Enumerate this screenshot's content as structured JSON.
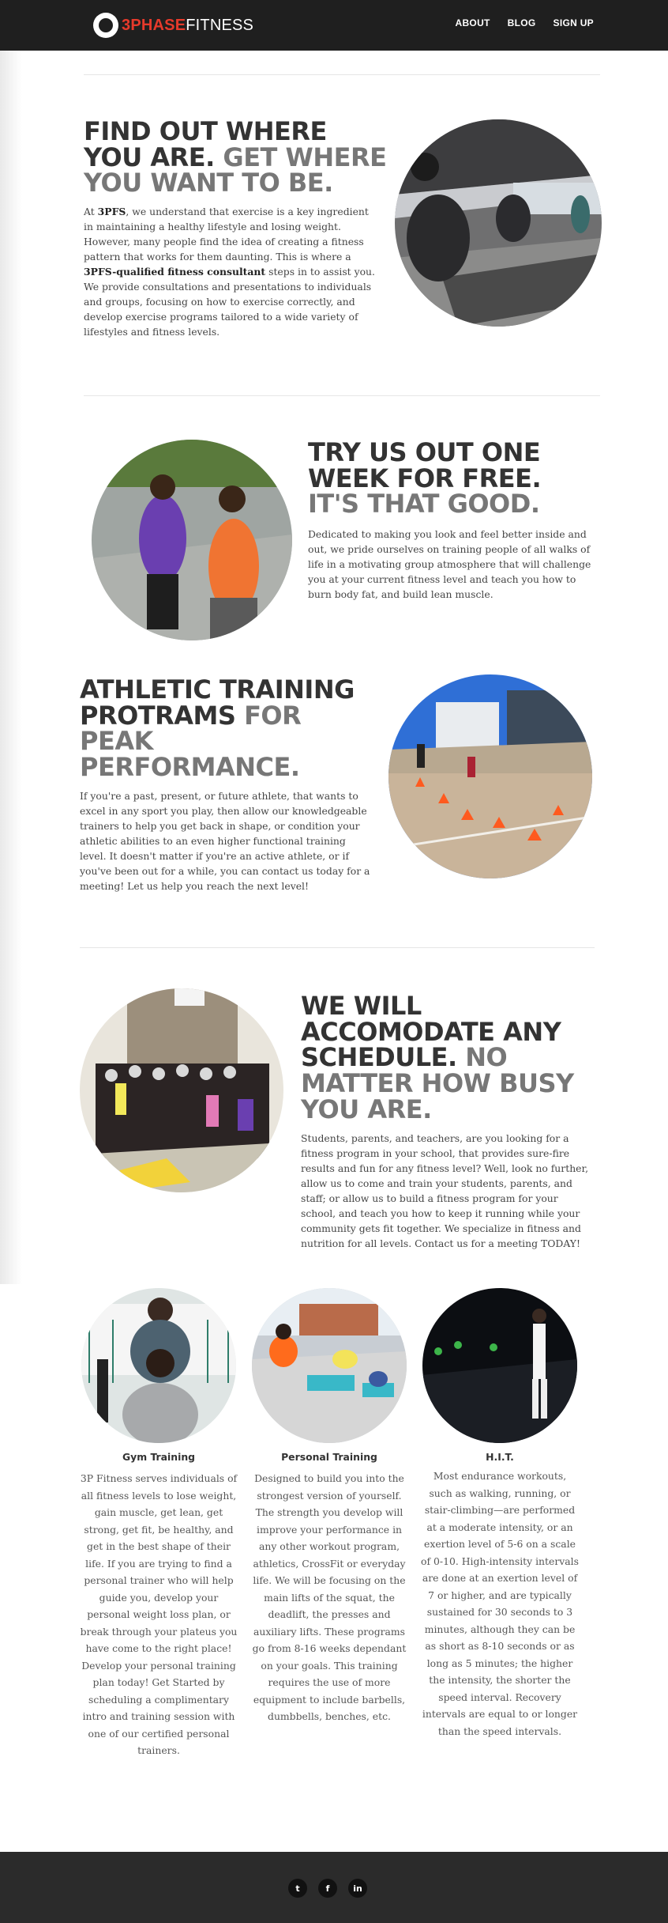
{
  "header": {
    "logo_mark_text": "3",
    "logo_number": "3",
    "logo_phase": "PHASE",
    "logo_fitness": "FITNESS",
    "nav": [
      "ABOUT",
      "BLOG",
      "SIGN UP"
    ]
  },
  "section1": {
    "heading_dark": "FIND OUT WHERE YOU ARE.",
    "heading_dim": "GET WHERE YOU WANT TO BE.",
    "p_before": "At ",
    "p_bold1": "3PFS",
    "p_mid": ", we understand that exercise is a key ingredient in maintaining a healthy lifestyle and losing weight. However, many people find the idea of creating a fitness pattern that works for them daunting. This is where a ",
    "p_bold2": "3PFS-qualified fitness consultant",
    "p_after": " steps in to assist you. We provide consultations and presentations to individuals and groups, focusing on  how to exercise correctly, and develop exercise programs tailored to a wide variety of  lifestyles and fitness levels."
  },
  "section2": {
    "heading_dark": "TRY US OUT ONE WEEK FOR FREE.",
    "heading_dim": "IT'S THAT GOOD.",
    "paragraph": "Dedicated to making you look and feel better inside and out, we pride ourselves on training people of all walks of life in a motivating group atmosphere that will challenge you at your current fitness level and teach you how to burn body fat, and build lean muscle."
  },
  "section3": {
    "heading_dark": "ATHLETIC TRAINING PROTRAMS",
    "heading_dim": "FOR PEAK PERFORMANCE.",
    "paragraph": "If you're a past, present, or future athlete, that wants to excel in any sport you play, then allow our knowledgeable trainers to help you get back in shape, or condition your athletic abilities to an even higher functional training level. It doesn't matter if you're an active athlete, or if you've been out for a while, you can contact us today for a meeting! Let us help you reach the next level!"
  },
  "section4": {
    "heading_dark": "WE WILL ACCOMODATE ANY SCHEDULE.",
    "heading_dim": "NO MATTER HOW BUSY YOU ARE.",
    "paragraph": "Students, parents, and teachers, are you looking for a fitness program in your school, that provides sure-fire results and fun for any fitness level? Well, look no further, allow us to come and train your students, parents, and staff; or allow us to build a fitness program for your school, and teach you how to keep it running while your community gets fit together. We specialize in fitness and nutrition for all levels. Contact us for a meeting TODAY!"
  },
  "services": [
    {
      "title": "Gym Training",
      "text": "3P Fitness serves individuals of all fitness levels to lose weight, gain muscle, get lean, get strong, get fit, be healthy, and get in the best shape of their life. If you are trying to find a personal trainer who will help guide you, develop your personal weight loss plan, or break through your plateus you have come to the right place! Develop your personal training plan today! Get Started by scheduling a complimentary intro and training session with one of our certified personal trainers."
    },
    {
      "title": "Personal Training",
      "text": "Designed to build you into the strongest version of yourself. The strength you develop will improve your performance in any other workout program, athletics, CrossFit or everyday life. We will be focusing on the main lifts of the squat, the deadlift, the presses and auxiliary lifts. These programs go from 8-16 weeks dependant on your goals. This training requires the use of more equipment to include barbells, dumbbells, benches, etc."
    },
    {
      "title": "H.I.T.",
      "text": "Most endurance workouts, such as walking, running, or stair-climbing—are performed at a moderate intensity, or an exertion level of 5-6 on a scale of 0-10. High-intensity intervals are done at an exertion level of 7 or higher, and are typically sustained for 30 seconds to 3 minutes, although they can be as short as 8-10 seconds or as long as 5 minutes; the higher the intensity, the shorter the speed interval. Recovery intervals are equal to or longer than the speed intervals."
    }
  ],
  "footer": {
    "social": [
      {
        "icon": "twitter-icon",
        "glyph": "t"
      },
      {
        "icon": "facebook-icon",
        "glyph": "f"
      },
      {
        "icon": "linkedin-icon",
        "glyph": "in"
      }
    ]
  },
  "colors": {
    "header_bg": "#1f1f1f",
    "brand_red": "#e63a2b",
    "heading_dark": "#333333",
    "heading_dim": "#777777",
    "footer_bg": "#2b2b2b"
  }
}
